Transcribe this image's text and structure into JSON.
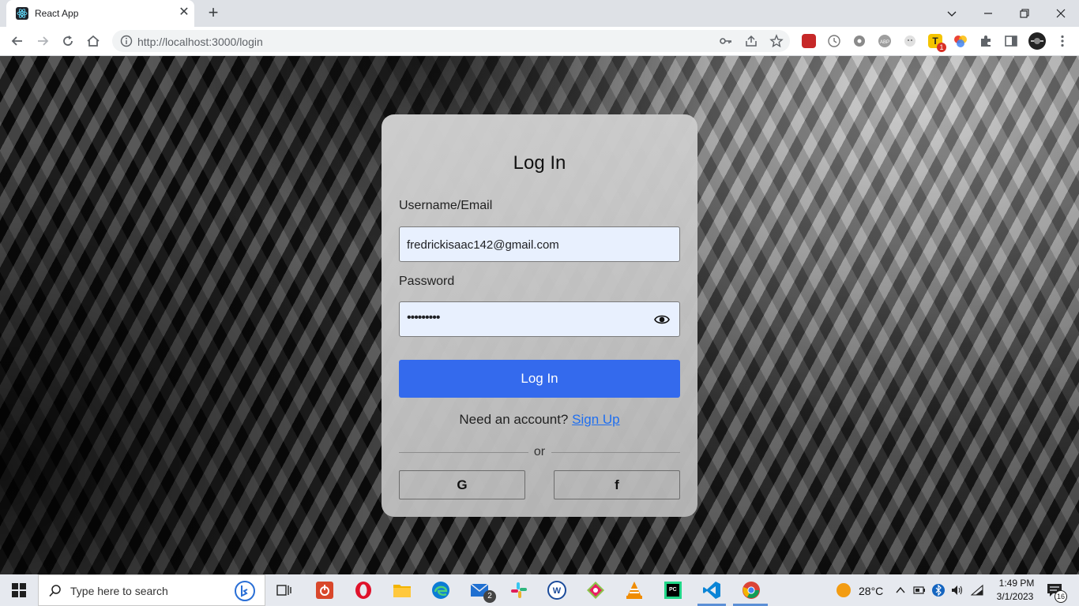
{
  "browser": {
    "tab_title": "React App",
    "tab_close": "✕",
    "new_tab": "+",
    "url": "http://localhost:3000/login",
    "extension_badge": "1"
  },
  "login": {
    "title": "Log In",
    "username_label": "Username/Email",
    "username_value": "fredrickisaac142@gmail.com",
    "password_label": "Password",
    "password_masked": "•••••••••",
    "submit_label": "Log In",
    "need_account_text": "Need an account?",
    "signup_link": "Sign Up",
    "or_text": "or",
    "google_glyph": "G",
    "facebook_glyph": "f",
    "colors": {
      "primary": "#346aed",
      "link": "#1e6ef0",
      "input_bg": "#e8f0fe"
    }
  },
  "taskbar": {
    "search_placeholder": "Type here to search",
    "mail_badge": "2",
    "temperature": "28°C",
    "time": "1:49 PM",
    "date": "3/1/2023",
    "notification_count": "16"
  }
}
